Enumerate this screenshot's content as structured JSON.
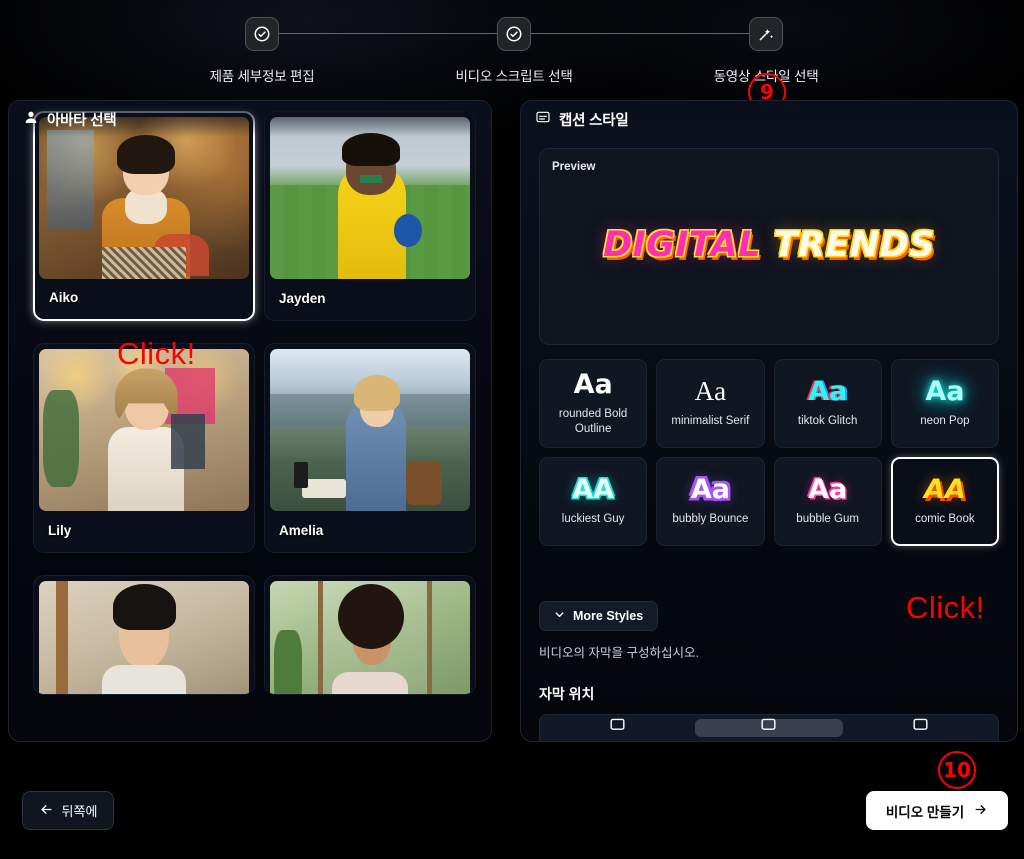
{
  "stepper": {
    "steps": [
      {
        "label": "제품 세부정보 편집",
        "icon": "check-circle-icon"
      },
      {
        "label": "비디오 스크립트 선택",
        "icon": "check-circle-icon"
      },
      {
        "label": "동영상 스타일 선택",
        "icon": "magic-wand-icon"
      }
    ]
  },
  "avatar_panel": {
    "icon": "avatar-icon",
    "title": "아바타 선택",
    "avatars": [
      {
        "name": "Aiko",
        "selected": true
      },
      {
        "name": "Jayden",
        "selected": false
      },
      {
        "name": "Lily",
        "selected": false
      },
      {
        "name": "Amelia",
        "selected": false
      },
      {
        "name": "",
        "selected": false
      },
      {
        "name": "",
        "selected": false
      }
    ]
  },
  "caption_panel": {
    "icon": "caption-icon",
    "title": "캡션 스타일",
    "preview": {
      "tag": "Preview",
      "word1": "DIGITAL",
      "word2": "TRENDS"
    },
    "styles": [
      {
        "glyph": "Aa",
        "name": "rounded Bold Outline",
        "class": "g-rounded",
        "selected": false
      },
      {
        "glyph": "Aa",
        "name": "minimalist Serif",
        "class": "g-serif",
        "selected": false
      },
      {
        "glyph": "Aa",
        "name": "tiktok Glitch",
        "class": "g-glitch",
        "selected": false
      },
      {
        "glyph": "Aa",
        "name": "neon Pop",
        "class": "g-neon",
        "selected": false
      },
      {
        "glyph": "AA",
        "name": "luckiest Guy",
        "class": "g-lucky",
        "selected": false
      },
      {
        "glyph": "Aa",
        "name": "bubbly Bounce",
        "class": "g-bubbly",
        "selected": false
      },
      {
        "glyph": "Aa",
        "name": "bubble Gum",
        "class": "g-gum",
        "selected": false
      },
      {
        "glyph": "AA",
        "name": "comic Book",
        "class": "g-comic",
        "selected": true
      }
    ],
    "more_styles_label": "More Styles",
    "more_styles_icon": "chevron-down-icon",
    "helper_text": "비디오의 자막을 구성하십시오.",
    "position_heading": "자막 위치",
    "positions": [
      {
        "icon": "caption-top-icon",
        "active": false
      },
      {
        "icon": "caption-middle-icon",
        "active": true
      },
      {
        "icon": "caption-bottom-icon",
        "active": false
      }
    ]
  },
  "footer": {
    "back_label": "뒤쪽에",
    "back_icon": "arrow-left-icon",
    "create_label": "비디오 만들기",
    "create_icon": "arrow-right-icon"
  },
  "annotations": {
    "marker9": "9",
    "marker10": "10",
    "click_avatar": "Click!",
    "click_style": "Click!",
    "color": "#ff0000"
  }
}
